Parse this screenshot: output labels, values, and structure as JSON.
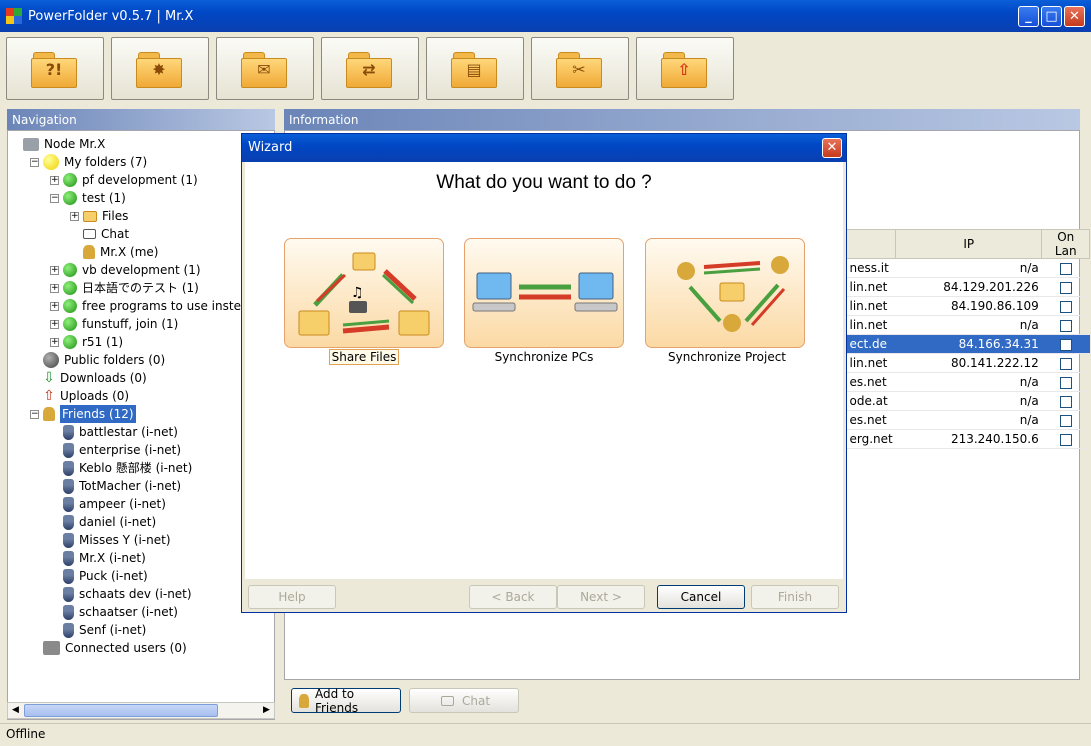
{
  "window": {
    "title": "PowerFolder v0.5.7 | Mr.X",
    "minimize": "_",
    "maximize": "□",
    "close": "✕"
  },
  "toolbar": [
    {
      "icon": "folder-question-icon",
      "glyph": "?!"
    },
    {
      "icon": "folder-new-icon",
      "glyph": "✸"
    },
    {
      "icon": "folder-mail-icon",
      "glyph": "✉"
    },
    {
      "icon": "folder-sync-icon",
      "glyph": "⇄"
    },
    {
      "icon": "folder-open-icon",
      "glyph": "▤"
    },
    {
      "icon": "folder-tools-icon",
      "glyph": "✂"
    },
    {
      "icon": "folder-exit-icon",
      "glyph": "⇧"
    }
  ],
  "navigation": {
    "header": "Navigation",
    "tree": [
      {
        "label": "Node Mr.X",
        "icon": "node"
      },
      {
        "label": "My folders (7)",
        "icon": "yellow"
      },
      {
        "label": "pf development (1)",
        "icon": "green"
      },
      {
        "label": "test (1)",
        "icon": "green"
      },
      {
        "label": "Files",
        "icon": "small-folder"
      },
      {
        "label": "Chat",
        "icon": "bubble"
      },
      {
        "label": "Mr.X (me)",
        "icon": "trophy"
      },
      {
        "label": "vb development (1)",
        "icon": "green"
      },
      {
        "label": "日本語でのテスト (1)",
        "icon": "green"
      },
      {
        "label": "free programs to use instead of",
        "icon": "green"
      },
      {
        "label": "funstuff, join (1)",
        "icon": "green"
      },
      {
        "label": "r51 (1)",
        "icon": "green"
      },
      {
        "label": "Public folders (0)",
        "icon": "gray"
      },
      {
        "label": "Downloads (0)",
        "icon": "arrow-down"
      },
      {
        "label": "Uploads (0)",
        "icon": "arrow-up"
      },
      {
        "label": "Friends (12)",
        "icon": "trophy"
      },
      {
        "label": "battlestar (i-net)",
        "icon": "user"
      },
      {
        "label": "enterprise (i-net)",
        "icon": "user"
      },
      {
        "label": "Keblo 懸部楼 (i-net)",
        "icon": "user"
      },
      {
        "label": "TotMacher (i-net)",
        "icon": "user"
      },
      {
        "label": "ampeer (i-net)",
        "icon": "user"
      },
      {
        "label": "daniel (i-net)",
        "icon": "user"
      },
      {
        "label": "Misses Y (i-net)",
        "icon": "user"
      },
      {
        "label": "Mr.X (i-net)",
        "icon": "user"
      },
      {
        "label": "Puck (i-net)",
        "icon": "user"
      },
      {
        "label": "schaats dev (i-net)",
        "icon": "user"
      },
      {
        "label": "schaatser (i-net)",
        "icon": "user"
      },
      {
        "label": "Senf (i-net)",
        "icon": "user"
      },
      {
        "label": "Connected users (0)",
        "icon": "network"
      }
    ]
  },
  "information": {
    "header": "Information",
    "columns": [
      "IP",
      "On Lan"
    ],
    "rows": [
      {
        "host": "ness.it",
        "ip": "n/a"
      },
      {
        "host": "lin.net",
        "ip": "84.129.201.226"
      },
      {
        "host": "lin.net",
        "ip": "84.190.86.109"
      },
      {
        "host": "lin.net",
        "ip": "n/a"
      },
      {
        "host": "ect.de",
        "ip": "84.166.34.31"
      },
      {
        "host": "lin.net",
        "ip": "80.141.222.12"
      },
      {
        "host": "es.net",
        "ip": "n/a"
      },
      {
        "host": "ode.at",
        "ip": "n/a"
      },
      {
        "host": "es.net",
        "ip": "n/a"
      },
      {
        "host": "erg.net",
        "ip": "213.240.150.6"
      }
    ],
    "add_friends": "Add to Friends",
    "chat": "Chat"
  },
  "wizard": {
    "title": "Wizard",
    "question": "What do you want to do ?",
    "options": [
      "Share Files",
      "Synchronize PCs",
      "Synchronize Project"
    ],
    "buttons": {
      "help": "Help",
      "back": "< Back",
      "next": "Next >",
      "cancel": "Cancel",
      "finish": "Finish"
    }
  },
  "status": "Offline"
}
